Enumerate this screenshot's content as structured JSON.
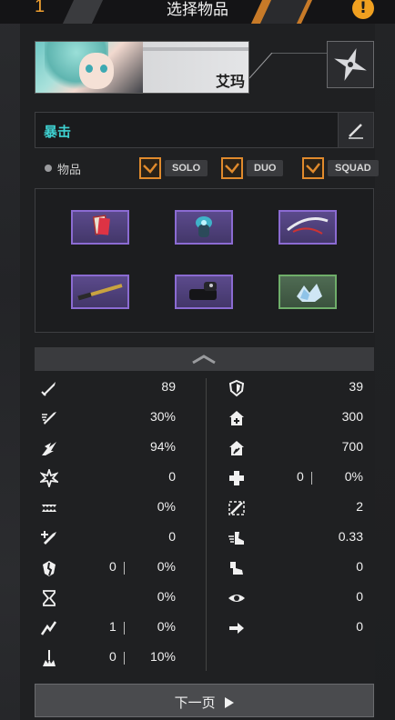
{
  "header": {
    "number": "1",
    "title": "选择物品",
    "warning_icon": "exclamation-icon"
  },
  "character": {
    "name": "艾玛"
  },
  "crit": {
    "label": "暴击"
  },
  "filter": {
    "label": "物品",
    "modes": [
      {
        "label": "SOLO",
        "checked": true
      },
      {
        "label": "DUO",
        "checked": true
      },
      {
        "label": "SQUAD",
        "checked": true
      }
    ]
  },
  "items": [
    {
      "name": "card-item",
      "rarity": "purple"
    },
    {
      "name": "capsule-item",
      "rarity": "purple"
    },
    {
      "name": "sword-item",
      "rarity": "purple"
    },
    {
      "name": "blade-item",
      "rarity": "purple"
    },
    {
      "name": "gauntlet-item",
      "rarity": "purple"
    },
    {
      "name": "crystal-item",
      "rarity": "green"
    }
  ],
  "stats_left": [
    {
      "icon": "sword-icon",
      "value": "89"
    },
    {
      "icon": "sword-speed-icon",
      "value": "30%"
    },
    {
      "icon": "crit-burst-icon",
      "value": "94%"
    },
    {
      "icon": "crit-damage-icon",
      "value": "0"
    },
    {
      "icon": "bite-icon",
      "value": "0%"
    },
    {
      "icon": "sword-plus-icon",
      "value": "0"
    },
    {
      "icon": "armor-break-icon",
      "value": "0",
      "value2": "0%"
    },
    {
      "icon": "hourglass-icon",
      "value": "0%"
    },
    {
      "icon": "lightning-icon",
      "value": "1",
      "value2": "0%"
    },
    {
      "icon": "splash-icon",
      "value": "0",
      "value2": "10%"
    }
  ],
  "stats_right": [
    {
      "icon": "shield-icon",
      "value": "39"
    },
    {
      "icon": "health-house-icon",
      "value": "300"
    },
    {
      "icon": "energy-house-icon",
      "value": "700"
    },
    {
      "icon": "heal-cross-icon",
      "value": "0",
      "value2": "0%"
    },
    {
      "icon": "blade-shield-icon",
      "value": "2"
    },
    {
      "icon": "boot-speed-icon",
      "value": "0.33"
    },
    {
      "icon": "step-icon",
      "value": "0"
    },
    {
      "icon": "eye-icon",
      "value": "0"
    },
    {
      "icon": "arrow-right-icon",
      "value": "0"
    }
  ],
  "next_page": {
    "label": "下一页"
  }
}
